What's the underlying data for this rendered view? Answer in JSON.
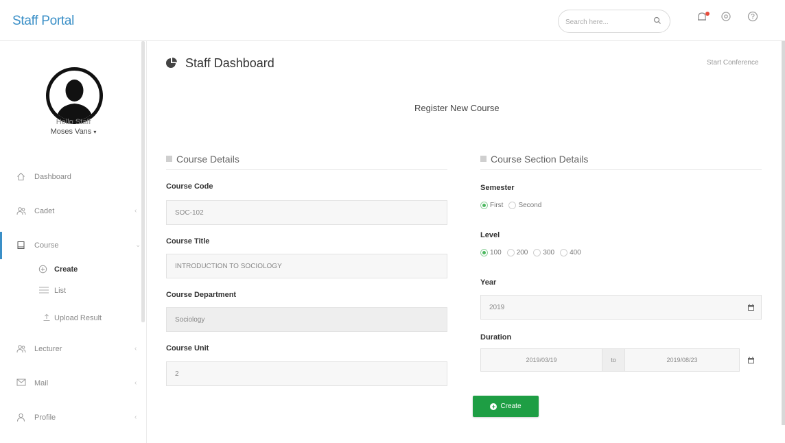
{
  "app": {
    "brand": "Staff Portal"
  },
  "topbar": {
    "search_placeholder": "Search here...",
    "icons": [
      "search-icon",
      "notification-icon",
      "settings-icon",
      "help-icon"
    ],
    "notification_dot_color": "#e74c3c"
  },
  "sidebar": {
    "greeting": "Hello Staff",
    "user_name": "Moses Vans",
    "items": [
      {
        "label": "Dashboard",
        "icon": "home-icon"
      },
      {
        "label": "Cadet",
        "icon": "users-icon"
      },
      {
        "label": "Course",
        "icon": "book-icon"
      },
      {
        "label": "Lecturer",
        "icon": "users-icon"
      },
      {
        "label": "Mail",
        "icon": "mail-icon"
      },
      {
        "label": "Profile",
        "icon": "user-icon"
      }
    ],
    "course_sub": [
      {
        "label": "Create",
        "icon": "plus-circle-icon"
      },
      {
        "label": "List",
        "icon": "list-icon"
      },
      {
        "label": "Upload Result",
        "icon": "upload-icon"
      }
    ]
  },
  "main": {
    "page_title": "Staff Dashboard",
    "start_conference": "Start Conference",
    "form_title": "Register New Course",
    "course_details": {
      "heading": "Course Details",
      "code_label": "Course Code",
      "code_value": "SOC-102",
      "title_label": "Course Title",
      "title_value": "INTRODUCTION TO SOCIOLOGY",
      "department_label": "Course Department",
      "department_value": "Sociology",
      "unit_label": "Course Unit",
      "unit_value": "2"
    },
    "section_details": {
      "heading": "Course Section Details",
      "semester_label": "Semester",
      "semester_options": [
        "First",
        "Second"
      ],
      "semester_selected": "First",
      "level_label": "Level",
      "level_options": [
        "100",
        "200",
        "300",
        "400"
      ],
      "level_selected": "100",
      "year_label": "Year",
      "year_value": "2019",
      "duration_label": "Duration",
      "duration_from": "2019/03/19",
      "duration_to_label": "to",
      "duration_to": "2019/08/23"
    },
    "create_button": "Create"
  },
  "colors": {
    "brand": "#3a8fc7",
    "accent_green": "#1e9e44",
    "radio_selected": "#4cb860"
  }
}
